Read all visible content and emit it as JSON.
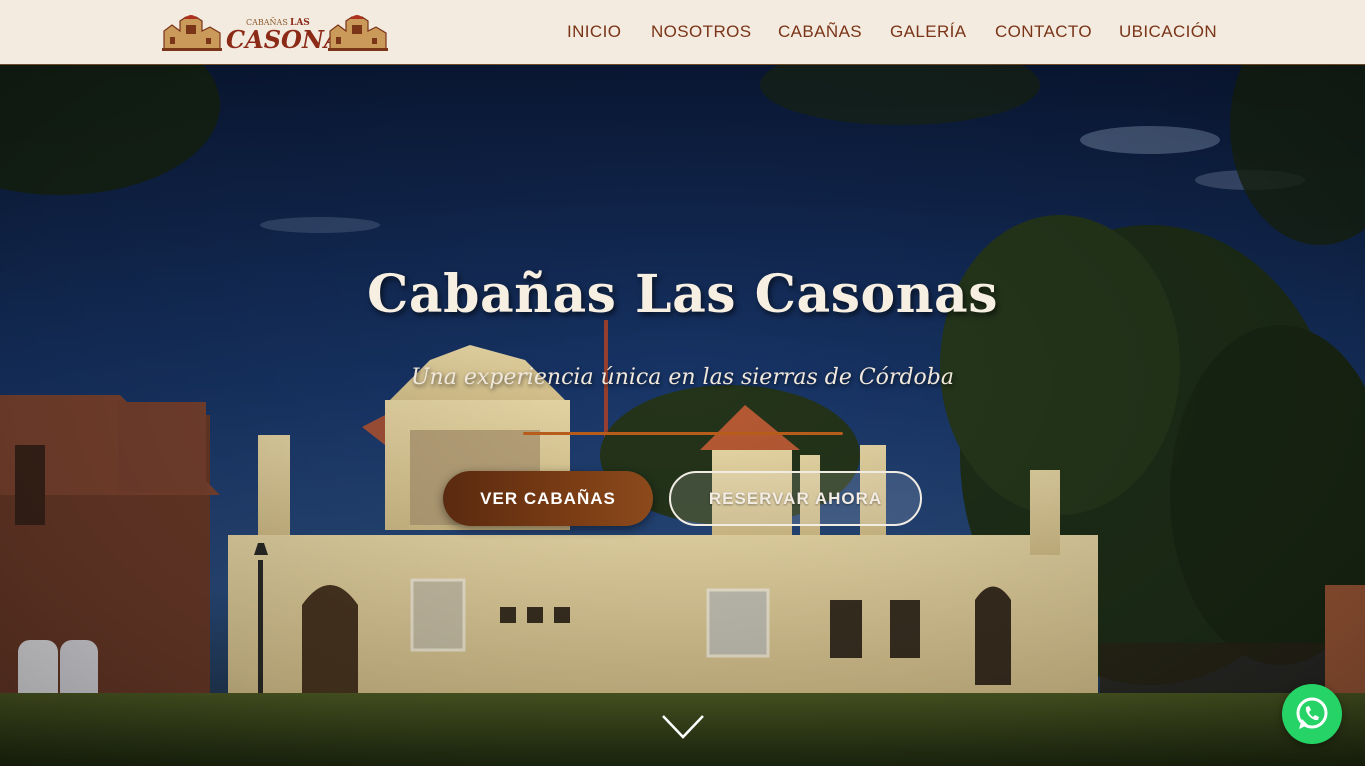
{
  "brand": {
    "logo_small_text": "CABAÑAS",
    "logo_small_text_2": "LAS",
    "logo_main_text": "CASONAS"
  },
  "nav": {
    "items": [
      {
        "label": "INICIO"
      },
      {
        "label": "NOSOTROS"
      },
      {
        "label": "CABAÑAS"
      },
      {
        "label": "GALERÍA"
      },
      {
        "label": "CONTACTO"
      },
      {
        "label": "UBICACIÓN"
      }
    ]
  },
  "hero": {
    "title": "Cabañas Las Casonas",
    "subtitle": "Una experiencia única en las sierras de Córdoba",
    "primary_button": "VER CABAÑAS",
    "secondary_button": "RESERVAR AHORA"
  },
  "icons": {
    "scroll_down": "chevron-down-icon",
    "whatsapp": "whatsapp-icon"
  },
  "colors": {
    "header_bg": "#f3ebdf",
    "nav_text": "#7a3418",
    "accent": "#b85c1c",
    "primary_button": "#6b3414",
    "whatsapp": "#25d366"
  }
}
